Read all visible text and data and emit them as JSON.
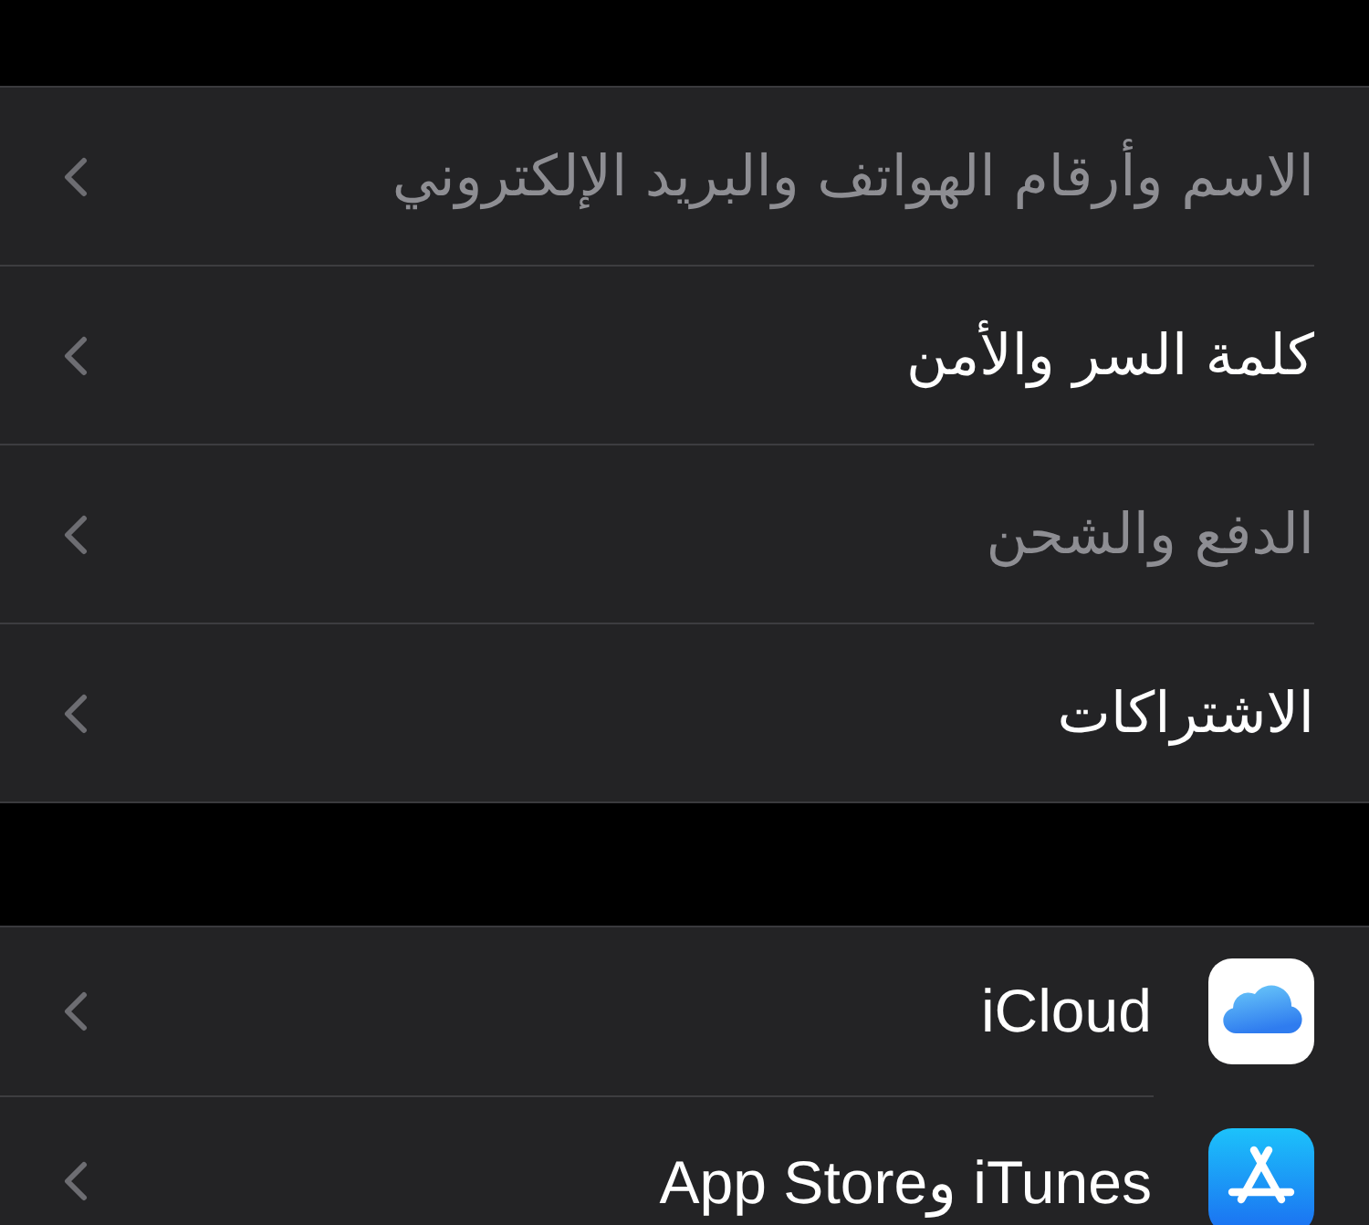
{
  "account_group": {
    "items": [
      {
        "label": "الاسم وأرقام الهواتف والبريد الإلكتروني",
        "disabled": true
      },
      {
        "label": "كلمة السر والأمن",
        "disabled": false
      },
      {
        "label": "الدفع والشحن",
        "disabled": true
      },
      {
        "label": "الاشتراكات",
        "disabled": false
      }
    ]
  },
  "services_group": {
    "items": [
      {
        "label": "iCloud",
        "kind": "icloud"
      },
      {
        "label": "iTunes وApp Store",
        "kind": "app-store"
      }
    ]
  }
}
